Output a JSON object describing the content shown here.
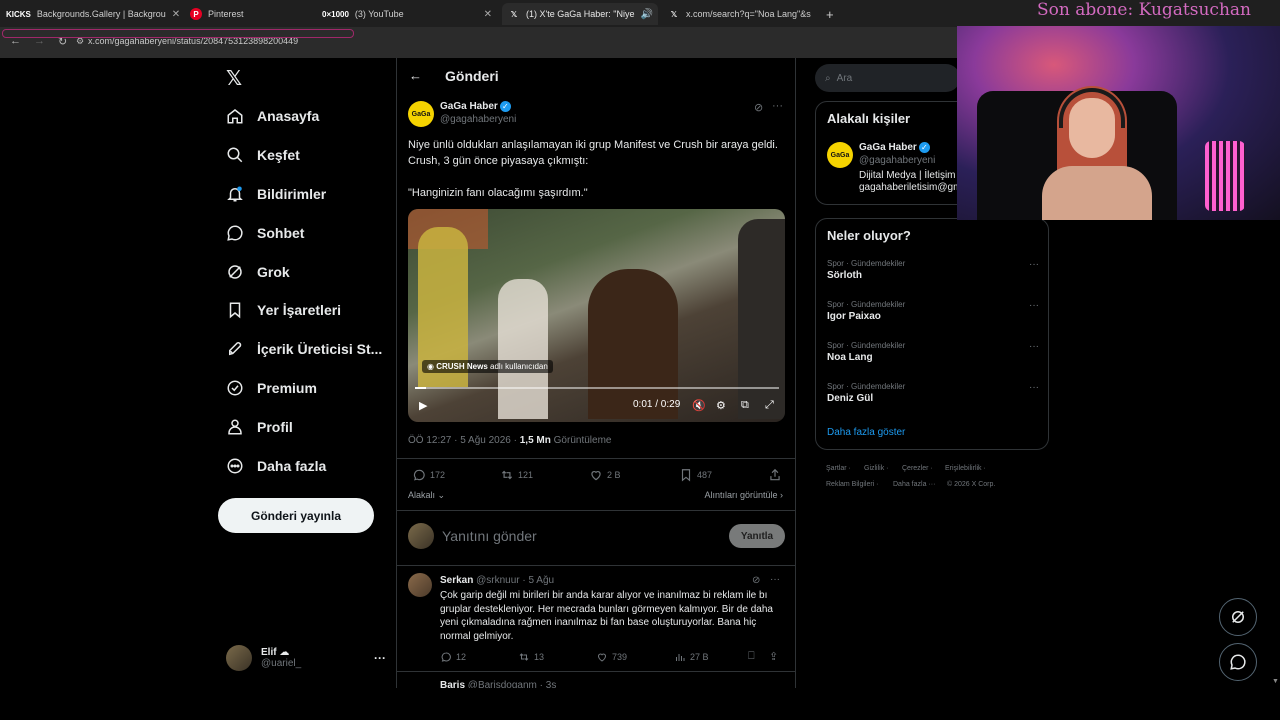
{
  "browser": {
    "tabs": [
      {
        "label": "Backgrounds.Gallery | Backgrou",
        "icon": "kicks-icon",
        "fav_text": "KICKS"
      },
      {
        "label": "Pinterest",
        "icon": "pinterest-icon"
      },
      {
        "label": "(3) YouTube",
        "icon": "youtube-icon",
        "fav_text": "0×1000"
      },
      {
        "label": "(1) X'te GaGa Haber: \"Niye",
        "icon": "x-icon"
      },
      {
        "label": "x.com/search?q=\"Noa Lang\"&s",
        "icon": "x-icon"
      }
    ],
    "url": "x.com/gagahaberyeni/status/2084753123898200449"
  },
  "stream_overlay": {
    "subscriber_text": "Son abone: Kugatsuchan"
  },
  "nav": {
    "items": [
      {
        "label": "Anasayfa",
        "icon": "home-icon"
      },
      {
        "label": "Keşfet",
        "icon": "search-icon"
      },
      {
        "label": "Bildirimler",
        "icon": "bell-icon",
        "badge": "1"
      },
      {
        "label": "Sohbet",
        "icon": "chat-icon"
      },
      {
        "label": "Grok",
        "icon": "grok-icon"
      },
      {
        "label": "Yer İşaretleri",
        "icon": "bookmark-icon"
      },
      {
        "label": "İçerik Üreticisi St...",
        "icon": "rocket-icon"
      },
      {
        "label": "Premium",
        "icon": "premium-icon"
      },
      {
        "label": "Profil",
        "icon": "profile-icon"
      },
      {
        "label": "Daha fazla",
        "icon": "more-circle-icon"
      }
    ],
    "post_button": "Gönderi yayınla",
    "user": {
      "name": "Elif ☁",
      "handle": "@uariel_"
    }
  },
  "post": {
    "header_title": "Gönderi",
    "author_name": "GaGa Haber",
    "author_handle": "@gagahaberyeni",
    "logo_text": "GaGa",
    "text_line1": "Niye ünlü oldukları anlaşılamayan iki grup Manifest ve Crush bir araya geldi. Crush, 3 gün önce piyasaya çıkmıştı:",
    "text_line2": "\"Hanginizin fanı olacağımı şaşırdım.\"",
    "video": {
      "badge_name": "CRUSH News",
      "badge_suffix": "adlı kullanıcıdan",
      "time": "0:01 / 0:29",
      "progress": 0.03
    },
    "meta_time": "ÖÖ 12:27 · 5 Ağu 2026 · ",
    "meta_views": "1,5 Mn",
    "meta_views_label": "Görüntüleme",
    "stats": {
      "replies": "172",
      "reposts": "121",
      "likes": "2 B",
      "bookmarks": "487"
    },
    "related_label": "Alakalı",
    "quotes_label": "Alıntıları görüntüle",
    "reply_placeholder": "Yanıtını gönder",
    "reply_button": "Yanıtla"
  },
  "comment": {
    "name": "Serkan",
    "handle_time": "@srknuur · 5 Ağu",
    "text": "Çok garip değil mi birileri bir anda karar alıyor ve inanılmaz bi reklam ile bı gruplar destekleniyor. Her mecrada bunları görmeyen kalmıyor. Bir de daha yeni çıkmaladına rağmen inanılmaz bi fan base oluşturuyorlar. Bana hiç normal gelmiyor.",
    "stats": {
      "replies": "12",
      "reposts": "13",
      "likes": "739",
      "views": "27 B"
    },
    "next_name": "Baris",
    "next_handle_time": "@Barisdoganm · 3s"
  },
  "right": {
    "search_placeholder": "Ara",
    "related_title": "Alakalı kişiler",
    "related_person": {
      "name": "GaGa Haber",
      "handle": "@gagahaberyeni",
      "bio_line1": "Dijital Medya | İletişim",
      "bio_line2": "gagahaberiletisim@gm"
    },
    "trends_title": "Neler oluyor?",
    "trends": [
      {
        "category": "Spor · Gündemdekiler",
        "name": "Sörloth"
      },
      {
        "category": "Spor · Gündemdekiler",
        "name": "Igor Paixao"
      },
      {
        "category": "Spor · Gündemdekiler",
        "name": "Noa Lang"
      },
      {
        "category": "Spor · Gündemdekiler",
        "name": "Deniz Gül"
      }
    ],
    "show_more": "Daha fazla göster",
    "footer": [
      "Şartlar ·",
      "Gizlilik ·",
      "Çerezler ·",
      "Erişilebilirlik ·",
      "Reklam Bilgileri ·",
      "Daha fazla ···",
      "© 2026 X Corp."
    ]
  },
  "colors": {
    "accent": "#1d9bf0",
    "background": "#000000",
    "text": "#e7e9ea",
    "muted": "#71767b",
    "border": "#2f3336",
    "overlay": "#d36ac0"
  }
}
